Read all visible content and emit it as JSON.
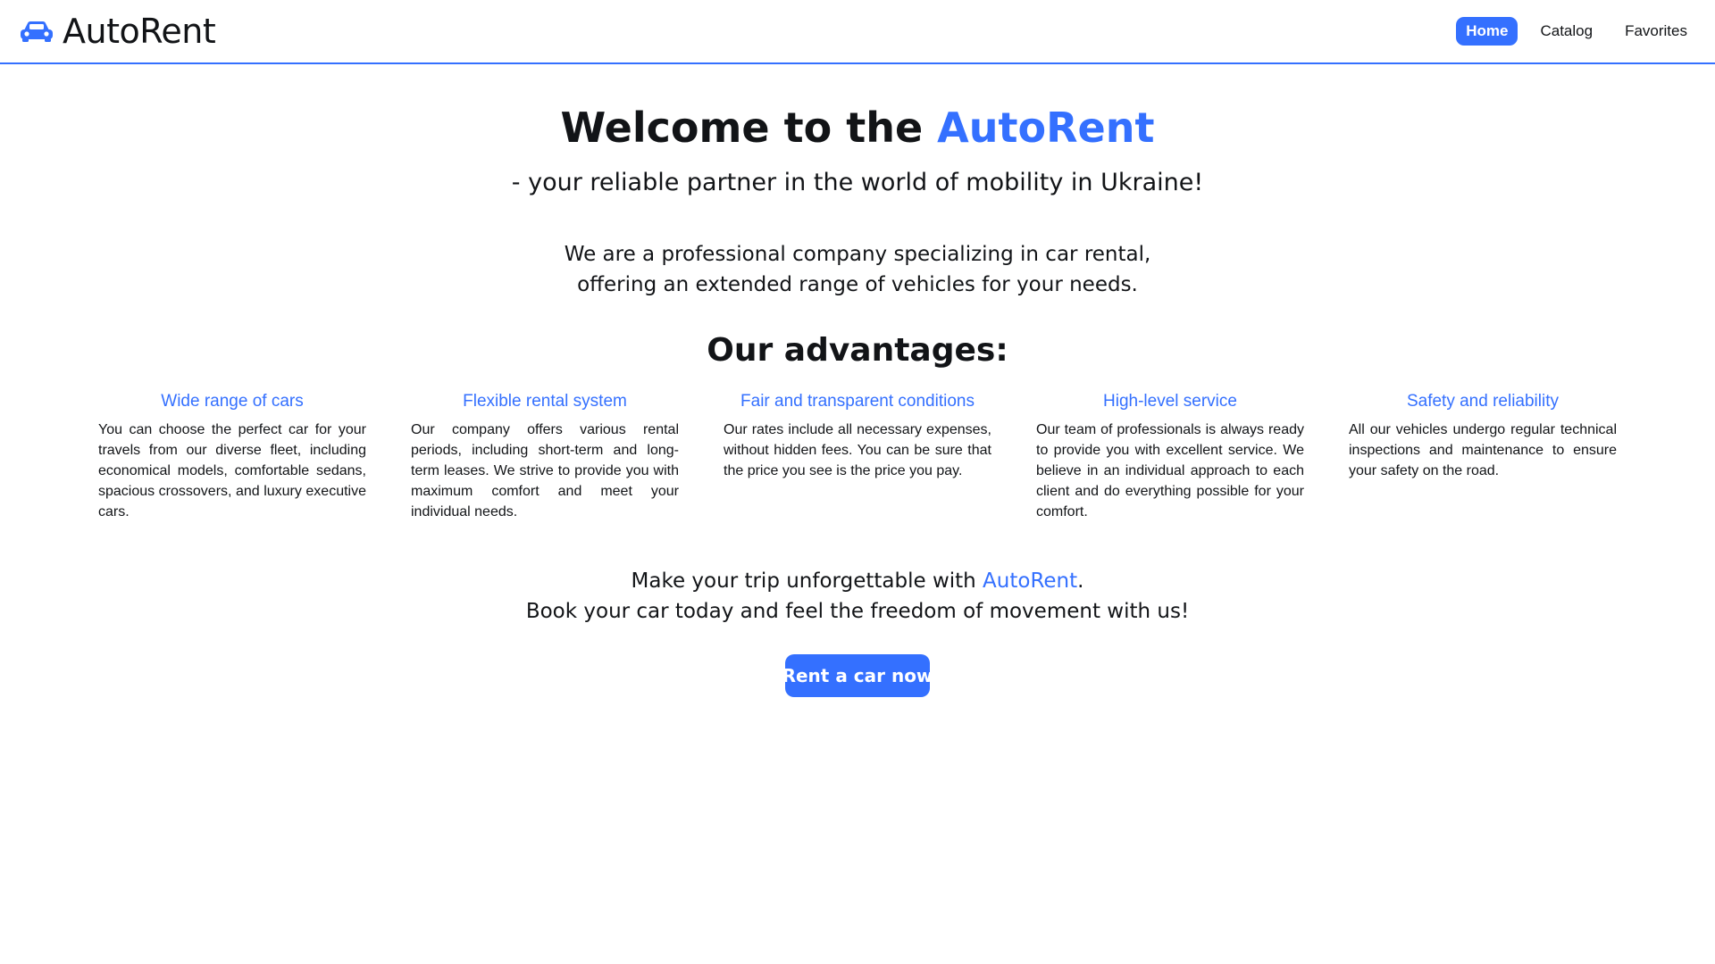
{
  "header": {
    "logo_text": "AutoRent",
    "logo_icon": "car-icon",
    "nav": [
      {
        "label": "Home",
        "active": true
      },
      {
        "label": "Catalog",
        "active": false
      },
      {
        "label": "Favorites",
        "active": false
      }
    ]
  },
  "hero": {
    "title_prefix": "Welcome to the ",
    "title_brand": "AutoRent",
    "subtitle": "- your reliable partner in the world of mobility in Ukraine!",
    "intro_line1": "We are a professional company specializing in car rental,",
    "intro_line2": "offering an extended range of vehicles for your needs."
  },
  "advantages": {
    "heading": "Our advantages:",
    "items": [
      {
        "title": "Wide range of cars",
        "text": "You can choose the perfect car for your travels from our diverse fleet, including economical models, comfortable sedans, spacious crossovers, and luxury executive cars."
      },
      {
        "title": "Flexible rental system",
        "text": "Our company offers various rental periods, including short-term and long-term leases. We strive to provide you with maximum comfort and meet your individual needs."
      },
      {
        "title": "Fair and transparent conditions",
        "text": "Our rates include all necessary expenses, without hidden fees. You can be sure that the price you see is the price you pay."
      },
      {
        "title": "High-level service",
        "text": "Our team of professionals is always ready to provide you with excellent service. We believe in an individual approach to each client and do everything possible for your comfort."
      },
      {
        "title": "Safety and reliability",
        "text": "All our vehicles undergo regular technical inspections and maintenance to ensure your safety on the road."
      }
    ]
  },
  "cta": {
    "line1_prefix": "Make your trip unforgettable with ",
    "line1_brand": "AutoRent",
    "line1_suffix": ".",
    "line2": "Book your car today and feel the freedom of movement with us!",
    "button_label": "Rent a car now"
  },
  "colors": {
    "accent": "#3470ff",
    "text": "#121417",
    "background": "#ffffff"
  }
}
